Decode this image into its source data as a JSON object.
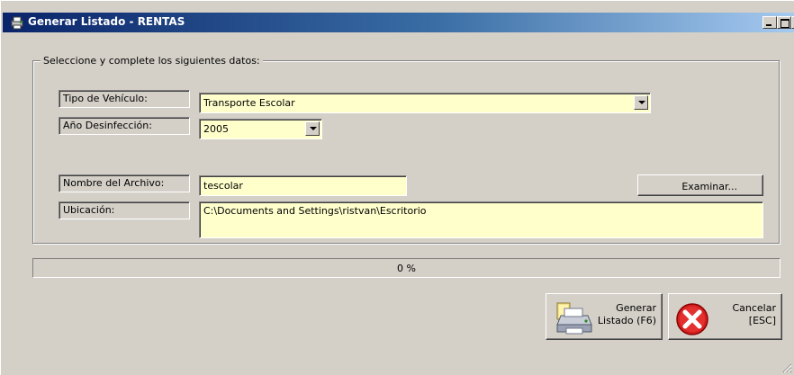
{
  "window": {
    "title": "Generar Listado - RENTAS",
    "app_icon": "printer-app-icon",
    "controls": [
      "minimize",
      "maximize",
      "close"
    ]
  },
  "form": {
    "group_label": "Seleccione y complete los siguientes datos:",
    "tipo_vehiculo": {
      "label": "Tipo de Vehículo:",
      "value": "Transporte Escolar"
    },
    "anio_desinfeccion": {
      "label": "Año Desinfección:",
      "value": "2005"
    },
    "nombre_archivo": {
      "label": "Nombre del Archivo:",
      "value": "tescolar"
    },
    "ubicacion": {
      "label": "Ubicación:",
      "value": "C:\\Documents and Settings\\ristvan\\Escritorio"
    },
    "browse_label": "Examinar..."
  },
  "progress": {
    "value": 0,
    "text": "0 %"
  },
  "buttons": {
    "generate": {
      "line1": "Generar",
      "line2": "Listado (F6)",
      "icon": "printer-icon"
    },
    "cancel": {
      "line1": "Cancelar",
      "line2": "[ESC]",
      "icon": "cancel-x-icon"
    }
  },
  "colors": {
    "title_start": "#0a246a",
    "title_end": "#a6caf0",
    "field_bg": "#ffffcc",
    "window_bg": "#d4d0c8",
    "cancel_red": "#d42020"
  }
}
